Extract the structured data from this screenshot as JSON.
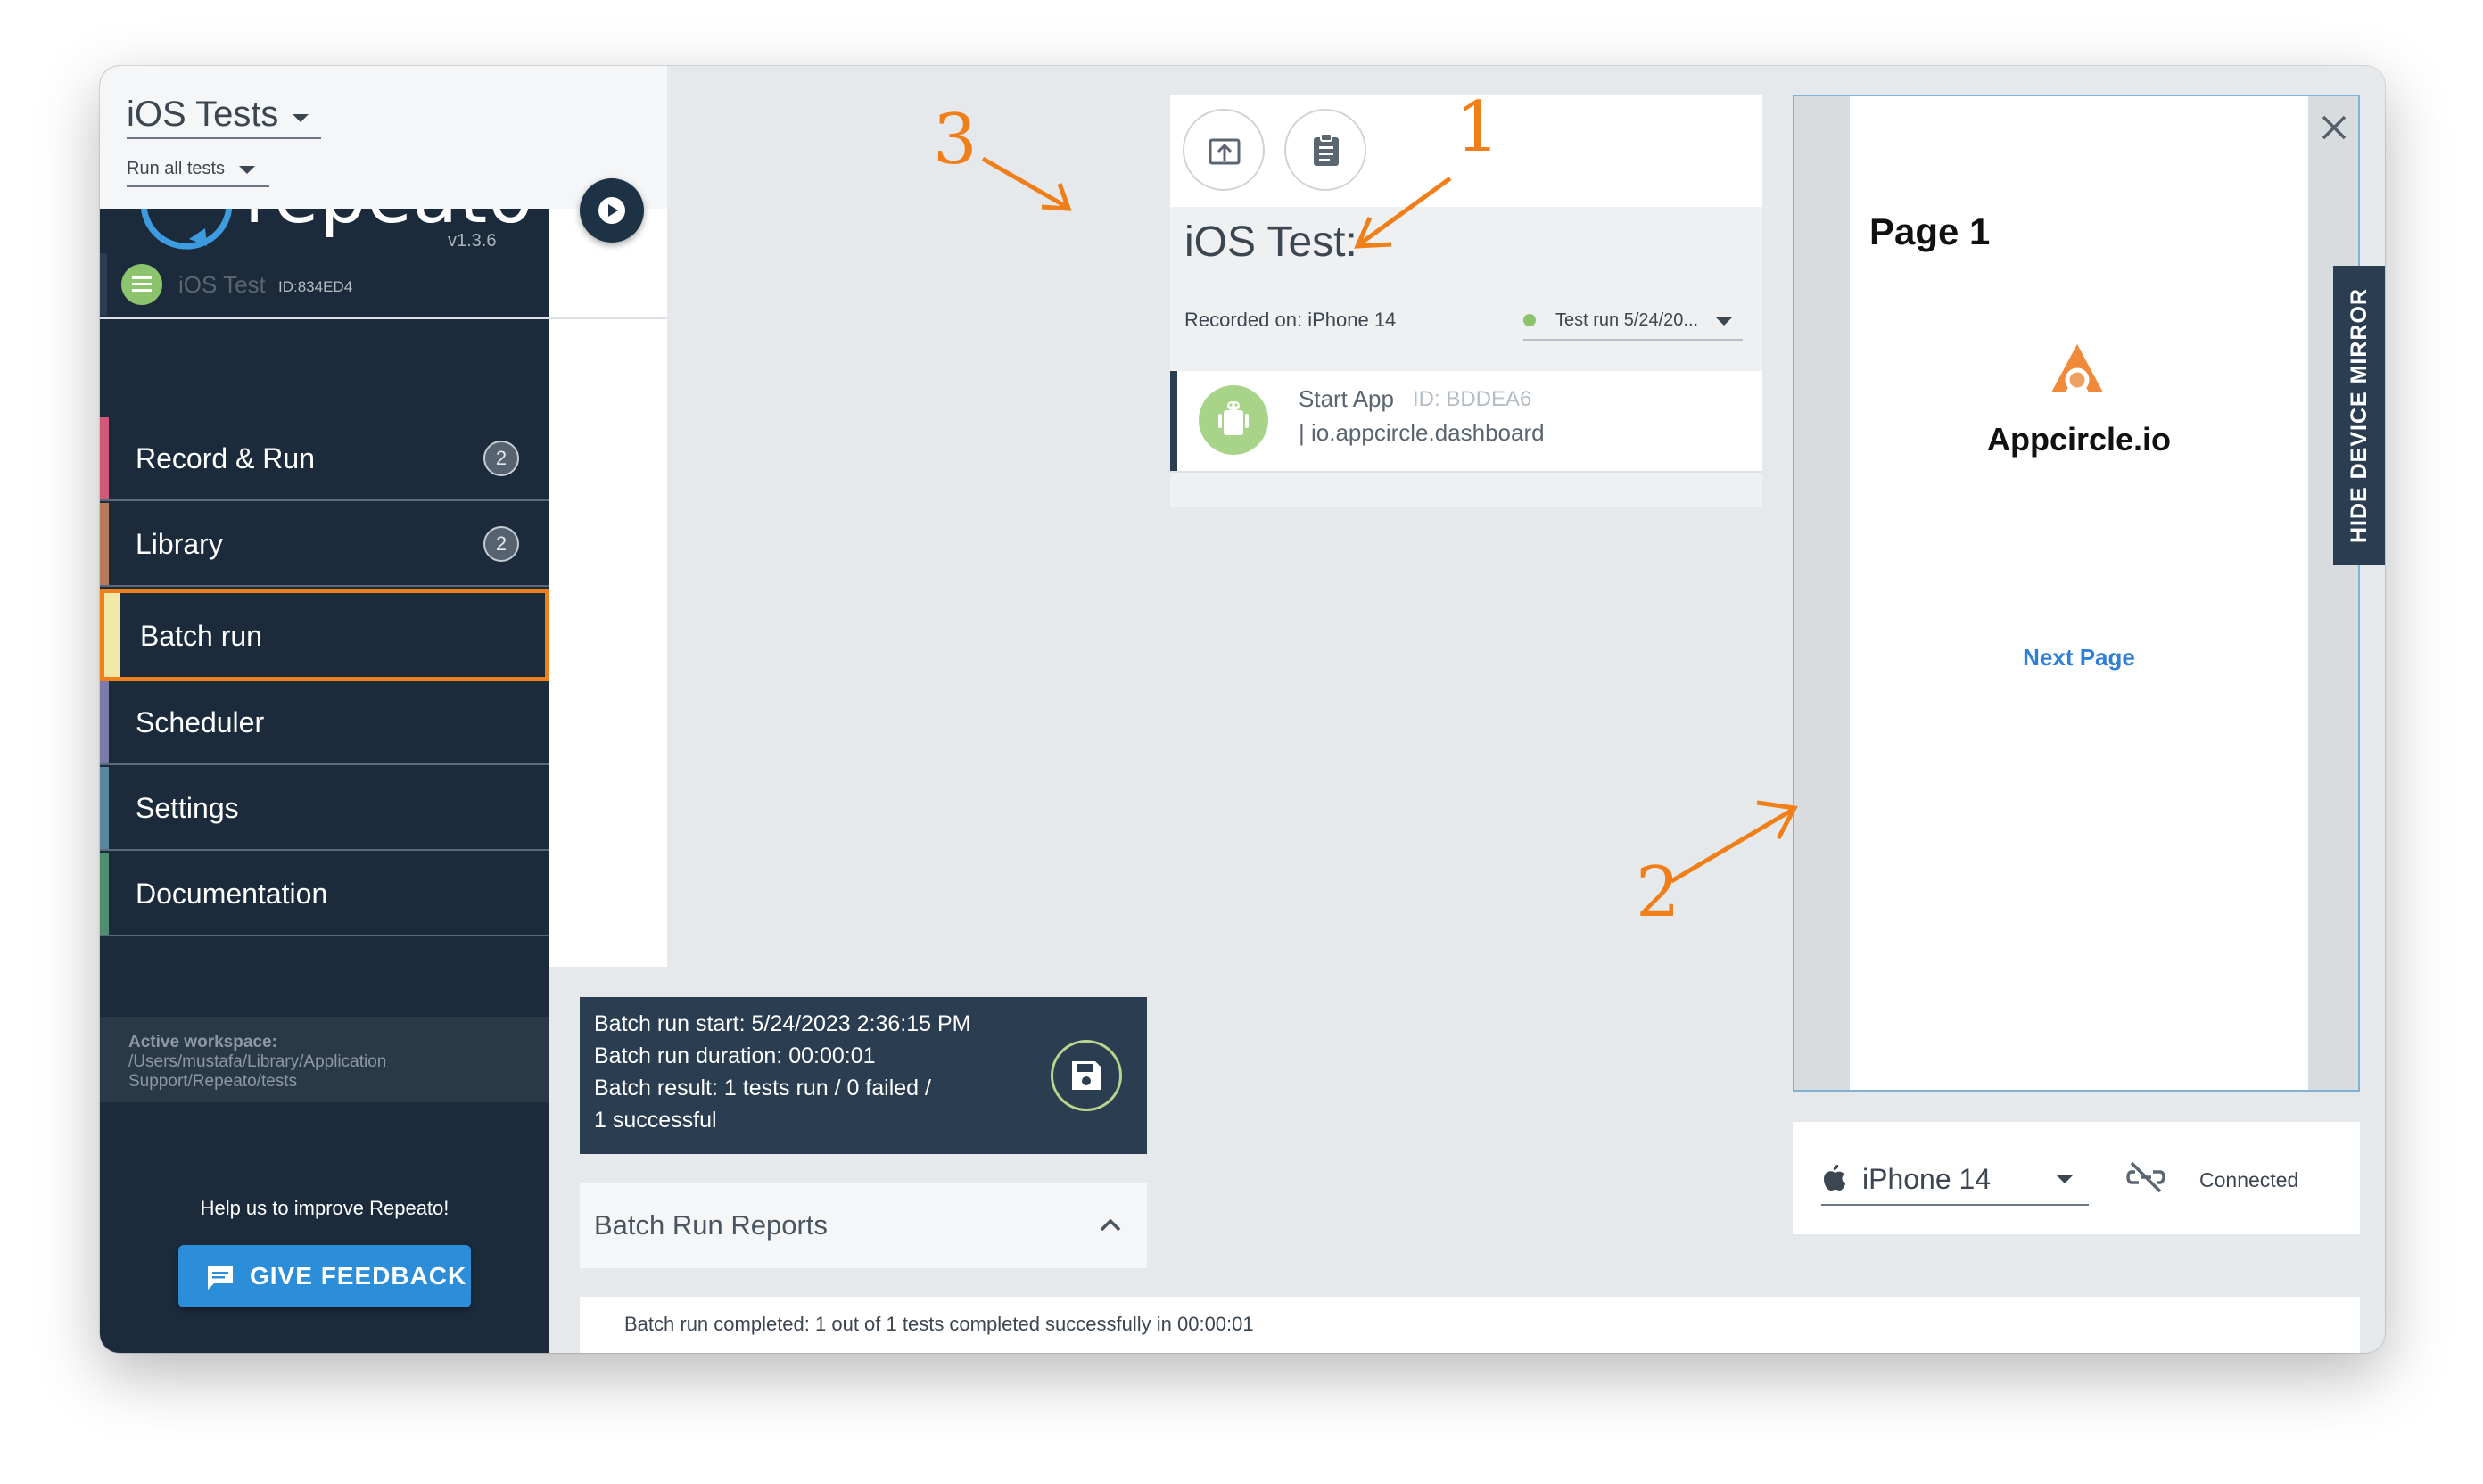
{
  "sidebar": {
    "brand": "repeato",
    "version": "v1.3.6",
    "nav": [
      {
        "label": "Record & Run",
        "badge": "2",
        "color": "#d05a78"
      },
      {
        "label": "Library",
        "badge": "2",
        "color": "#b87a5c"
      },
      {
        "label": "Batch run",
        "badge": "",
        "color": "#f3e9a6"
      },
      {
        "label": "Scheduler",
        "badge": "",
        "color": "#7b7ba8"
      },
      {
        "label": "Settings",
        "badge": "",
        "color": "#5a86a0"
      },
      {
        "label": "Documentation",
        "badge": "",
        "color": "#4f8f6f"
      }
    ],
    "workspace": {
      "line1": "Active workspace:",
      "line2": "/Users/mustafa/Library/Application",
      "line3": "Support/Repeato/tests"
    },
    "help_text": "Help us to improve Repeato!",
    "feedback_label": "GIVE FEEDBACK"
  },
  "tests": {
    "suite_label": "iOS Tests",
    "run_mode": "Run all tests",
    "items": [
      {
        "name": "iOS Test",
        "id": "ID:834ED4"
      }
    ]
  },
  "batch_summary": {
    "start": "Batch run start: 5/24/2023 2:36:15 PM",
    "duration": "Batch run duration: 00:00:01",
    "result": "Batch result: 1 tests run / 0 failed /",
    "result2": "1 successful"
  },
  "reports": {
    "title": "Batch Run Reports"
  },
  "detail": {
    "title": "iOS Test:",
    "recorded_on": "Recorded on: iPhone 14",
    "test_run": "Test run 5/24/20...",
    "steps": [
      {
        "name": "Start App",
        "id": "ID: BDDEA6",
        "detail": "| io.appcircle.dashboard"
      }
    ]
  },
  "mirror": {
    "page_title": "Page 1",
    "app_name": "Appcircle.io",
    "link": "Next Page",
    "hide_label": "HIDE DEVICE MIRROR"
  },
  "device": {
    "name": "iPhone 14",
    "status": "Connected"
  },
  "status_message": "Batch run completed: 1 out of 1 tests completed successfully in 00:00:01",
  "annotations": {
    "one": "1",
    "two": "2",
    "three": "3"
  },
  "colors": {
    "accent": "#f07f1a",
    "sidebar_bg": "#1b2b3b",
    "primary_button": "#2c8ed8",
    "green": "#8cc46e"
  }
}
